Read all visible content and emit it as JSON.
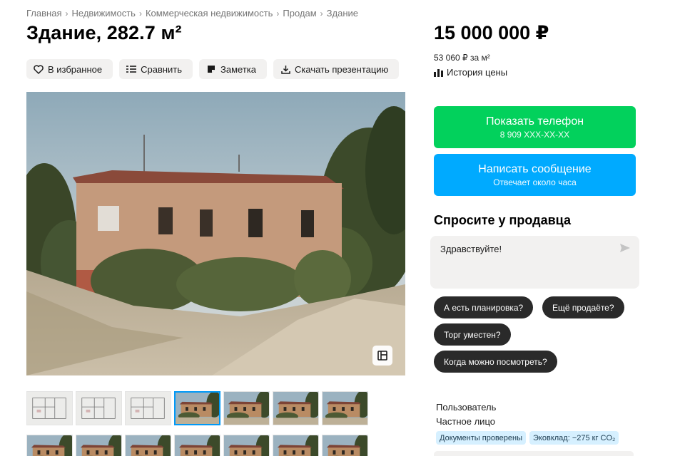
{
  "breadcrumbs": [
    "Главная",
    "Недвижимость",
    "Коммерческая недвижимость",
    "Продам",
    "Здание"
  ],
  "breadcrumb_separator": "›",
  "title": "Здание, 282.7 м²",
  "actions": [
    {
      "label": "В избранное",
      "icon": "heart-icon"
    },
    {
      "label": "Сравнить",
      "icon": "compare-icon"
    },
    {
      "label": "Заметка",
      "icon": "note-icon"
    },
    {
      "label": "Скачать презентацию",
      "icon": "download-icon"
    }
  ],
  "price": {
    "value": "15 000 000 ₽",
    "per_meter": "53 060 ₽ за м²",
    "history_label": "История цены"
  },
  "contact": {
    "phone_label": "Показать телефон",
    "phone_masked": "8 909 XXX-XX-XX",
    "message_label": "Написать сообщение",
    "message_sub": "Отвечает около часа"
  },
  "ask": {
    "title": "Спросите у продавца",
    "message": "Здравствуйте!",
    "chips": [
      "А есть планировка?",
      "Ещё продаёте?",
      "Торг уместен?",
      "Когда можно посмотреть?"
    ]
  },
  "seller": {
    "role": "Пользователь",
    "type": "Частное лицо",
    "badges": [
      "Документы проверены",
      "Эковклад: −275 кг CO₂"
    ]
  },
  "gallery": {
    "selected_index": 3,
    "thumbnails": [
      "floorplan",
      "floorplan",
      "floorplan",
      "building",
      "building",
      "building",
      "building",
      "building",
      "building",
      "building",
      "building",
      "building",
      "building",
      "building"
    ]
  },
  "colors": {
    "phone_button": "#02d15c",
    "message_button": "#00aaff",
    "chip": "#2a2a2a",
    "badge": "#d6f0ff",
    "selected_thumb": "#0099f7"
  }
}
